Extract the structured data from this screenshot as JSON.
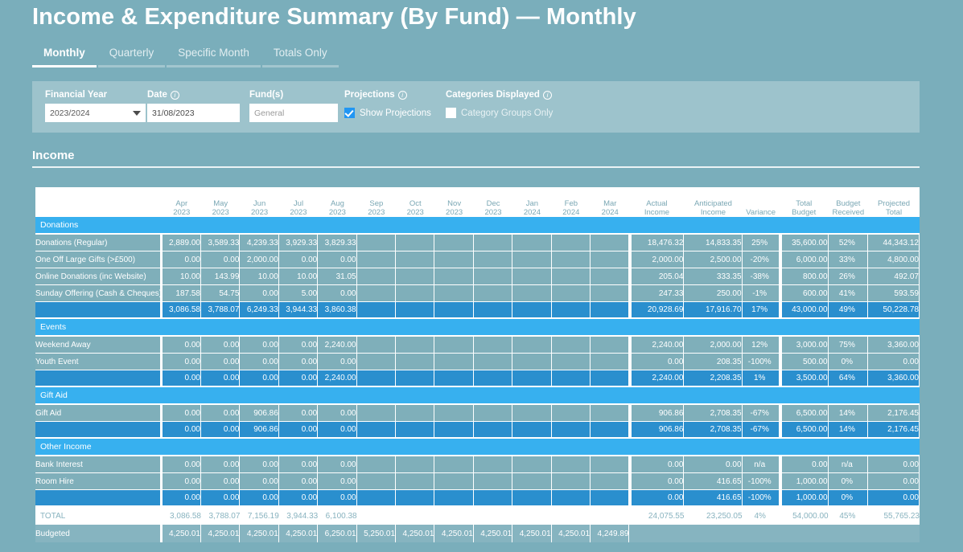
{
  "page_title": "Income & Expenditure Summary (By Fund) — Monthly",
  "tabs": [
    {
      "label": "Monthly",
      "active": true
    },
    {
      "label": "Quarterly",
      "active": false
    },
    {
      "label": "Specific Month",
      "active": false
    },
    {
      "label": "Totals Only",
      "active": false
    }
  ],
  "filters": {
    "financial_year": {
      "label": "Financial Year",
      "value": "2023/2024",
      "icon": "chevron-down-icon"
    },
    "date": {
      "label": "Date",
      "info": "info-icon",
      "value": "31/08/2023"
    },
    "funds": {
      "label": "Fund(s)",
      "value": "General"
    },
    "projections": {
      "label": "Projections",
      "info": "info-icon",
      "checkbox_label": "Show Projections",
      "checked": true
    },
    "categories_displayed": {
      "label": "Categories Displayed",
      "info": "info-icon",
      "checkbox_label": "Category Groups Only",
      "checked": false
    }
  },
  "section": {
    "title": "Income"
  },
  "table": {
    "columns": [
      {
        "line1": "",
        "line2": ""
      },
      {
        "line1": "Apr",
        "line2": "2023"
      },
      {
        "line1": "May",
        "line2": "2023"
      },
      {
        "line1": "Jun",
        "line2": "2023"
      },
      {
        "line1": "Jul",
        "line2": "2023"
      },
      {
        "line1": "Aug",
        "line2": "2023"
      },
      {
        "line1": "Sep",
        "line2": "2023"
      },
      {
        "line1": "Oct",
        "line2": "2023"
      },
      {
        "line1": "Nov",
        "line2": "2023"
      },
      {
        "line1": "Dec",
        "line2": "2023"
      },
      {
        "line1": "Jan",
        "line2": "2024"
      },
      {
        "line1": "Feb",
        "line2": "2024"
      },
      {
        "line1": "Mar",
        "line2": "2024"
      },
      {
        "line1": "Actual",
        "line2": "Income"
      },
      {
        "line1": "Anticipated",
        "line2": "Income"
      },
      {
        "line1": "Variance",
        "line2": ""
      },
      {
        "line1": "Total",
        "line2": "Budget"
      },
      {
        "line1": "Budget",
        "line2": "Received"
      },
      {
        "line1": "Projected",
        "line2": "Total"
      }
    ],
    "groups": [
      {
        "name": "Donations",
        "rows": [
          {
            "label": "Donations (Regular)",
            "months": [
              "2,889.00",
              "3,589.33",
              "4,239.33",
              "3,929.33",
              "3,829.33",
              "",
              "",
              "",
              "",
              "",
              "",
              ""
            ],
            "actual": "18,476.32",
            "anticipated": "14,833.35",
            "variance": "25%",
            "total_budget": "35,600.00",
            "budget_received": "52%",
            "projected_total": "44,343.12"
          },
          {
            "label": "One Off Large Gifts (>£500)",
            "months": [
              "0.00",
              "0.00",
              "2,000.00",
              "0.00",
              "0.00",
              "",
              "",
              "",
              "",
              "",
              "",
              ""
            ],
            "actual": "2,000.00",
            "anticipated": "2,500.00",
            "variance": "-20%",
            "total_budget": "6,000.00",
            "budget_received": "33%",
            "projected_total": "4,800.00"
          },
          {
            "label": "Online Donations (inc Website)",
            "months": [
              "10.00",
              "143.99",
              "10.00",
              "10.00",
              "31.05",
              "",
              "",
              "",
              "",
              "",
              "",
              ""
            ],
            "actual": "205.04",
            "anticipated": "333.35",
            "variance": "-38%",
            "total_budget": "800.00",
            "budget_received": "26%",
            "projected_total": "492.07"
          },
          {
            "label": "Sunday Offering (Cash & Cheques)",
            "months": [
              "187.58",
              "54.75",
              "0.00",
              "5.00",
              "0.00",
              "",
              "",
              "",
              "",
              "",
              "",
              ""
            ],
            "actual": "247.33",
            "anticipated": "250.00",
            "variance": "-1%",
            "total_budget": "600.00",
            "budget_received": "41%",
            "projected_total": "593.59"
          }
        ],
        "subtotal": {
          "label": "",
          "months": [
            "3,086.58",
            "3,788.07",
            "6,249.33",
            "3,944.33",
            "3,860.38",
            "",
            "",
            "",
            "",
            "",
            "",
            ""
          ],
          "actual": "20,928.69",
          "anticipated": "17,916.70",
          "variance": "17%",
          "total_budget": "43,000.00",
          "budget_received": "49%",
          "projected_total": "50,228.78"
        }
      },
      {
        "name": "Events",
        "rows": [
          {
            "label": "Weekend Away",
            "months": [
              "0.00",
              "0.00",
              "0.00",
              "0.00",
              "2,240.00",
              "",
              "",
              "",
              "",
              "",
              "",
              ""
            ],
            "actual": "2,240.00",
            "anticipated": "2,000.00",
            "variance": "12%",
            "total_budget": "3,000.00",
            "budget_received": "75%",
            "projected_total": "3,360.00"
          },
          {
            "label": "Youth Event",
            "months": [
              "0.00",
              "0.00",
              "0.00",
              "0.00",
              "0.00",
              "",
              "",
              "",
              "",
              "",
              "",
              ""
            ],
            "actual": "0.00",
            "anticipated": "208.35",
            "variance": "-100%",
            "total_budget": "500.00",
            "budget_received": "0%",
            "projected_total": "0.00"
          }
        ],
        "subtotal": {
          "label": "",
          "months": [
            "0.00",
            "0.00",
            "0.00",
            "0.00",
            "2,240.00",
            "",
            "",
            "",
            "",
            "",
            "",
            ""
          ],
          "actual": "2,240.00",
          "anticipated": "2,208.35",
          "variance": "1%",
          "total_budget": "3,500.00",
          "budget_received": "64%",
          "projected_total": "3,360.00"
        }
      },
      {
        "name": "Gift Aid",
        "rows": [
          {
            "label": "Gift Aid",
            "months": [
              "0.00",
              "0.00",
              "906.86",
              "0.00",
              "0.00",
              "",
              "",
              "",
              "",
              "",
              "",
              ""
            ],
            "actual": "906.86",
            "anticipated": "2,708.35",
            "variance": "-67%",
            "total_budget": "6,500.00",
            "budget_received": "14%",
            "projected_total": "2,176.45"
          }
        ],
        "subtotal": {
          "label": "",
          "months": [
            "0.00",
            "0.00",
            "906.86",
            "0.00",
            "0.00",
            "",
            "",
            "",
            "",
            "",
            "",
            ""
          ],
          "actual": "906.86",
          "anticipated": "2,708.35",
          "variance": "-67%",
          "total_budget": "6,500.00",
          "budget_received": "14%",
          "projected_total": "2,176.45"
        }
      },
      {
        "name": "Other Income",
        "rows": [
          {
            "label": "Bank Interest",
            "months": [
              "0.00",
              "0.00",
              "0.00",
              "0.00",
              "0.00",
              "",
              "",
              "",
              "",
              "",
              "",
              ""
            ],
            "actual": "0.00",
            "anticipated": "0.00",
            "variance": "n/a",
            "total_budget": "0.00",
            "budget_received": "n/a",
            "projected_total": "0.00"
          },
          {
            "label": "Room Hire",
            "months": [
              "0.00",
              "0.00",
              "0.00",
              "0.00",
              "0.00",
              "",
              "",
              "",
              "",
              "",
              "",
              ""
            ],
            "actual": "0.00",
            "anticipated": "416.65",
            "variance": "-100%",
            "total_budget": "1,000.00",
            "budget_received": "0%",
            "projected_total": "0.00"
          }
        ],
        "subtotal": {
          "label": "",
          "months": [
            "0.00",
            "0.00",
            "0.00",
            "0.00",
            "0.00",
            "",
            "",
            "",
            "",
            "",
            "",
            ""
          ],
          "actual": "0.00",
          "anticipated": "416.65",
          "variance": "-100%",
          "total_budget": "1,000.00",
          "budget_received": "0%",
          "projected_total": "0.00"
        }
      }
    ],
    "total_row": {
      "label": "TOTAL",
      "months": [
        "3,086.58",
        "3,788.07",
        "7,156.19",
        "3,944.33",
        "6,100.38",
        "",
        "",
        "",
        "",
        "",
        "",
        ""
      ],
      "actual": "24,075.55",
      "anticipated": "23,250.05",
      "variance": "4%",
      "total_budget": "54,000.00",
      "budget_received": "45%",
      "projected_total": "55,765.23"
    },
    "budgeted_row": {
      "label": "Budgeted",
      "months": [
        "4,250.01",
        "4,250.01",
        "4,250.01",
        "4,250.01",
        "6,250.01",
        "5,250.01",
        "4,250.01",
        "4,250.01",
        "4,250.01",
        "4,250.01",
        "4,250.01",
        "4,249.89"
      ],
      "actual": "",
      "anticipated": "",
      "variance": "",
      "total_budget": "",
      "budget_received": "",
      "projected_total": ""
    }
  },
  "colors": {
    "page_bg": "#7aaebb",
    "filter_bg": "#9dc3cc",
    "group_header": "#37b0ef",
    "row_bg": "#7fafba",
    "subtotal_bg": "#2a8fce",
    "budgeted_bg": "#86b4c0",
    "header_text": "#7aa7b4"
  }
}
